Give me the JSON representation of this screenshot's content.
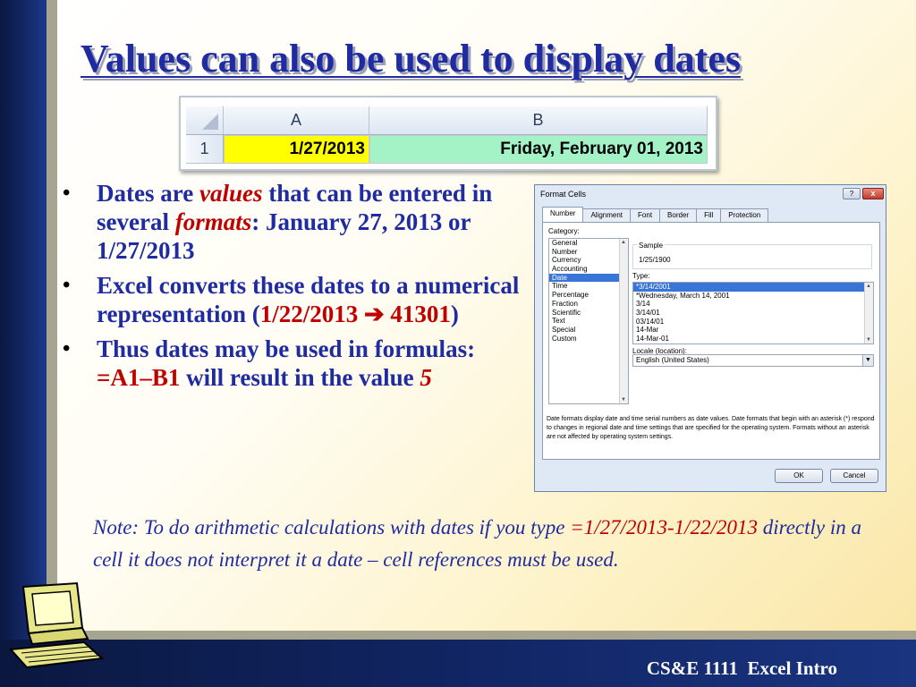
{
  "slide": {
    "title": "Values can also be used to display dates",
    "footer": "CS&E 1111  Excel Intro"
  },
  "sheet": {
    "col_a": "A",
    "col_b": "B",
    "row_num": "1",
    "cell_a1": "1/27/2013",
    "cell_b1": "Friday, February 01, 2013",
    "colors": {
      "a1_fill": "#ffff00",
      "b1_fill": "#a3f3c6"
    }
  },
  "bullets": {
    "b1": {
      "t1": "Dates are ",
      "t2": "values",
      "t3": " that can be entered in several ",
      "t4": "formats",
      "t5": ": January 27, 2013 or 1/27/2013"
    },
    "b2": {
      "t1": "Excel converts these dates to a numerical representation (",
      "t2": "1/22/2013 ",
      "arrow": "➔",
      "t3": " 41301",
      "t4": ")"
    },
    "b3": {
      "t1": "Thus dates may be used in formulas: ",
      "t2": "=A1–B1",
      "t3": " will result in the value ",
      "t4": "5"
    }
  },
  "note": {
    "t1": "Note: To do arithmetic calculations with dates if you type ",
    "t2": "=1/27/2013-1/22/2013",
    "t3": "  directly in a cell it does not interpret it a date – cell references must be used."
  },
  "dialog": {
    "title": "Format Cells",
    "help": "?",
    "close": "x",
    "tabs": [
      "Number",
      "Alignment",
      "Font",
      "Border",
      "Fill",
      "Protection"
    ],
    "category_label": "Category:",
    "categories": [
      "General",
      "Number",
      "Currency",
      "Accounting",
      "Date",
      "Time",
      "Percentage",
      "Fraction",
      "Scientific",
      "Text",
      "Special",
      "Custom"
    ],
    "sample_label": "Sample",
    "sample_value": "1/25/1900",
    "type_label": "Type:",
    "types": [
      "*3/14/2001",
      "*Wednesday, March 14, 2001",
      "3/14",
      "3/14/01",
      "03/14/01",
      "14-Mar",
      "14-Mar-01"
    ],
    "locale_label": "Locale (location):",
    "locale_value": "English (United States)",
    "description": "Date formats display date and time serial numbers as date values.  Date formats that begin with an asterisk (*) respond to changes in regional date and time settings that are specified for the operating system. Formats without an asterisk are not affected by operating system settings.",
    "ok": "OK",
    "cancel": "Cancel"
  },
  "colors": {
    "title": "#1f2ba0",
    "highlight": "#c00000",
    "sidebar": "#14296a"
  }
}
